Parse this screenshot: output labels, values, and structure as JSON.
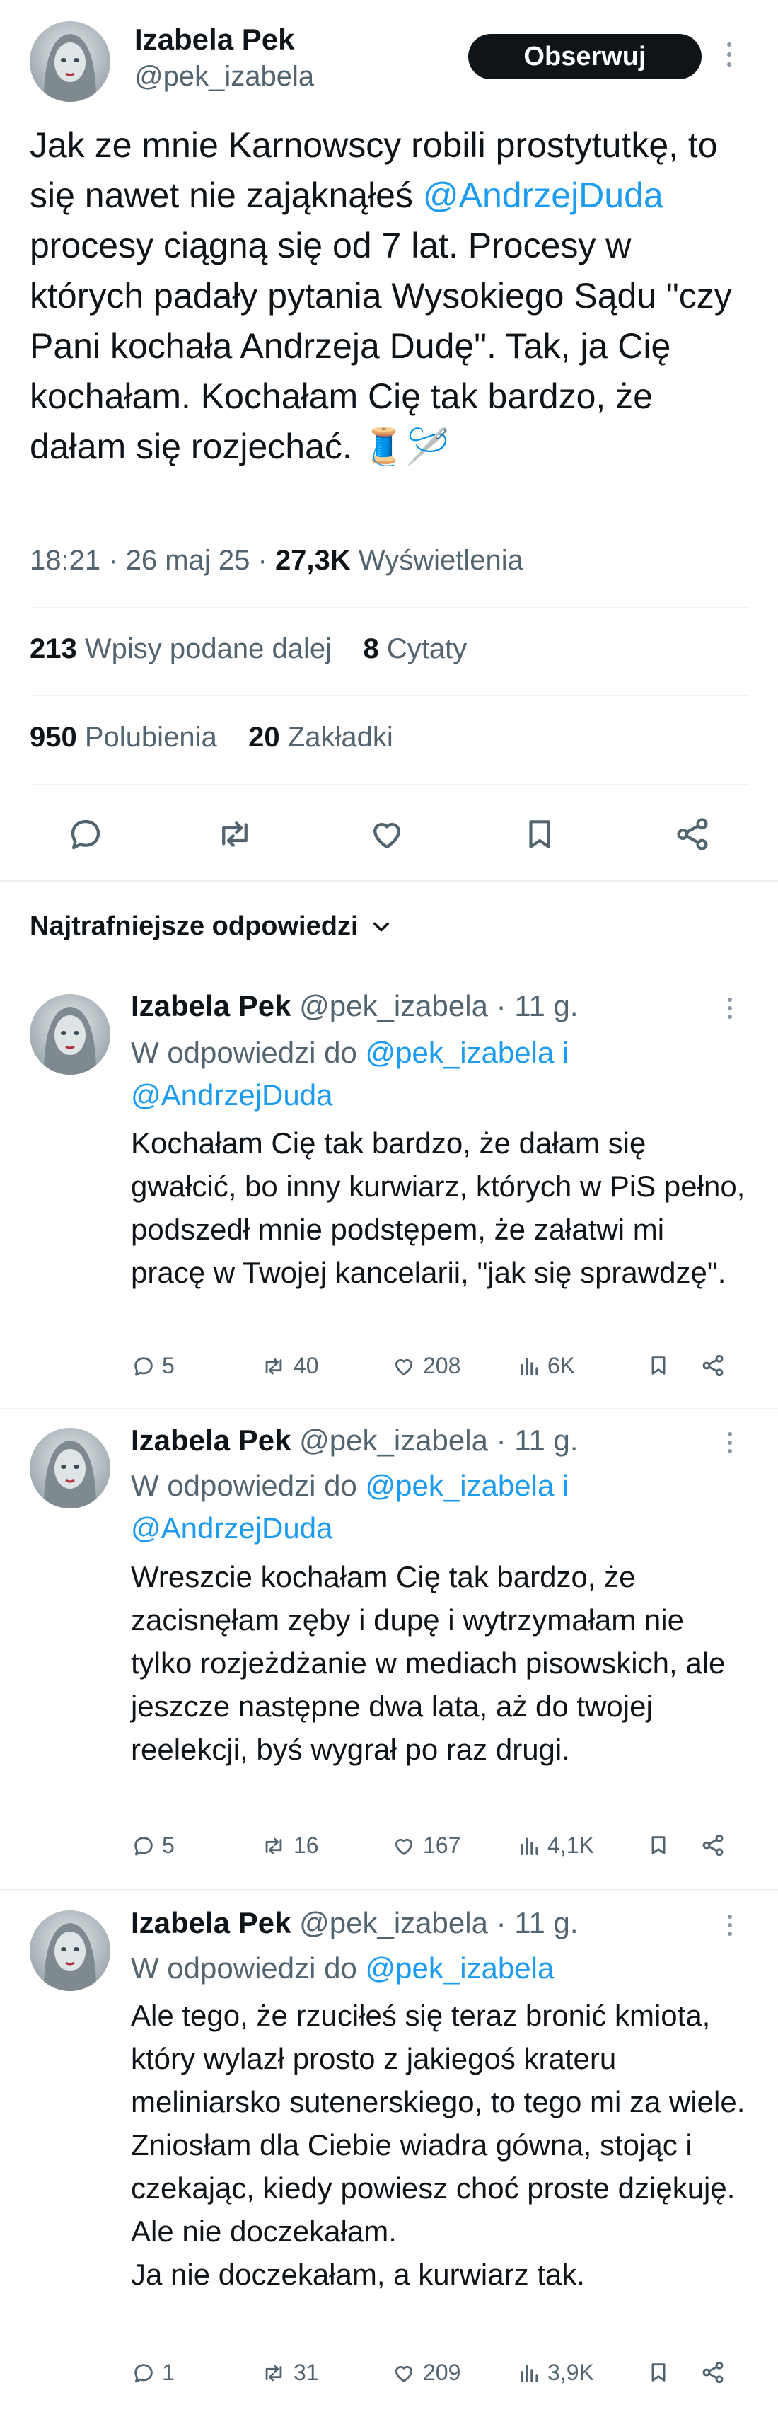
{
  "post": {
    "author_name": "Izabela Pek",
    "author_handle": "@pek_izabela",
    "follow_label": "Obserwuj",
    "text_before_mention": "Jak ze mnie Karnowscy robili prostytutkę, to się nawet nie zająknąłeś ",
    "mention": "@AndrzejDuda",
    "text_after_mention": " procesy ciągną się od 7 lat. Procesy w których padały pytania Wysokiego Sądu \"czy Pani kochała Andrzeja Dudę\". Tak, ja Cię kochałam. Kochałam Cię tak bardzo, że dałam się rozjechać. 🧵🪡",
    "time": "18:21",
    "date": "26 maj 25",
    "sep": "·",
    "views_count": "27,3K",
    "views_label": "Wyświetlenia",
    "reposts_count": "213",
    "reposts_label": "Wpisy podane dalej",
    "quotes_count": "8",
    "quotes_label": "Cytaty",
    "likes_count": "950",
    "likes_label": "Polubienia",
    "bookmarks_count": "20",
    "bookmarks_label": "Zakładki",
    "actions": [
      "reply-icon",
      "repost-icon",
      "like-icon",
      "bookmark-icon",
      "share-icon"
    ]
  },
  "replies_header": {
    "label": "Najtrafniejsze odpowiedzi"
  },
  "replies": [
    {
      "name": "Izabela Pek",
      "handle": "@pek_izabela",
      "time": "· 11 g.",
      "reply_to_prefix": "W odpowiedzi do",
      "reply_to_1": "@pek_izabela",
      "reply_to_and": "i",
      "reply_to_2": "@AndrzejDuda",
      "text": "Kochałam Cię tak bardzo, że dałam się gwałcić, bo inny kurwiarz, których w PiS pełno, podszedł mnie podstępem, że załatwi mi pracę w Twojej kancelarii, \"jak się sprawdzę\".",
      "replies": "5",
      "reposts": "40",
      "likes": "208",
      "views": "6K"
    },
    {
      "name": "Izabela Pek",
      "handle": "@pek_izabela",
      "time": "· 11 g.",
      "reply_to_prefix": "W odpowiedzi do",
      "reply_to_1": "@pek_izabela",
      "reply_to_and": "i",
      "reply_to_2": "@AndrzejDuda",
      "text": "Wreszcie kochałam Cię tak bardzo, że zacisnęłam zęby i dupę i wytrzymałam nie tylko rozjeżdżanie w mediach pisowskich, ale jeszcze następne dwa lata, aż do twojej reelekcji, byś wygrał po raz drugi.",
      "replies": "5",
      "reposts": "16",
      "likes": "167",
      "views": "4,1K"
    },
    {
      "name": "Izabela Pek",
      "handle": "@pek_izabela",
      "time": "· 11 g.",
      "reply_to_prefix": "W odpowiedzi do",
      "reply_to_1": "@pek_izabela",
      "text": "Ale tego, że rzuciłeś się teraz bronić kmiota, który wylazł prosto z jakiegoś krateru meliniarsko sutenerskiego, to tego mi za wiele. Zniosłam dla Ciebie wiadra gówna, stojąc i czekając, kiedy powiesz choć proste dziękuję.\nAle nie doczekałam.\nJa nie doczekałam, a kurwiarz tak.",
      "replies": "1",
      "reposts": "31",
      "likes": "209",
      "views": "3,9K"
    }
  ],
  "colors": {
    "text": "#0f1419",
    "muted": "#536471",
    "link": "#1d9bf0",
    "divider": "#eff3f4",
    "button": "#0f1419"
  }
}
